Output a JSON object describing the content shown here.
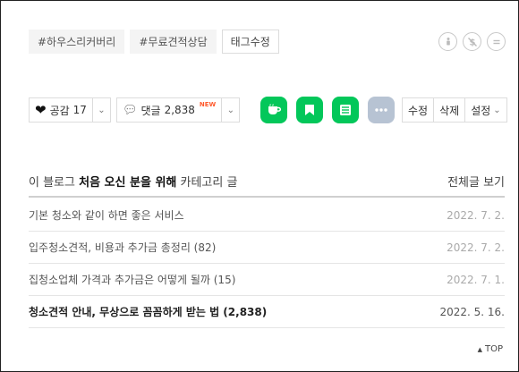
{
  "tags": [
    "#하우스리커버리",
    "#무료견적상담"
  ],
  "tag_edit_label": "태그수정",
  "cc_icons": [
    "cc-by-icon",
    "cc-nc-icon",
    "cc-nd-icon"
  ],
  "actions": {
    "like_label": "공감",
    "like_count": "17",
    "comment_label": "댓글",
    "comment_count": "2,838",
    "new_badge": "NEW"
  },
  "share_icons": [
    "cafe-icon",
    "blog-icon",
    "memo-icon",
    "more-icon"
  ],
  "manage": {
    "edit": "수정",
    "delete": "삭제",
    "settings": "설정"
  },
  "category": {
    "title_prefix": "이 블로그 ",
    "title_bold": "처음 오신 분을 위해",
    "title_suffix": " 카테고리 글",
    "view_all": "전체글 보기"
  },
  "posts": [
    {
      "title": "기본 청소와 같이 하면 좋은 서비스",
      "date": "2022. 7. 2."
    },
    {
      "title": "입주청소견적, 비용과 추가금 총정리 (82)",
      "date": "2022. 7. 2."
    },
    {
      "title": "집청소업체 가격과 추가금은 어떻게 될까 (15)",
      "date": "2022. 7. 1."
    },
    {
      "title": "청소견적 안내, 무상으로 꼼꼼하게 받는 법 (2,838)",
      "date": "2022. 5. 16."
    }
  ],
  "top_label": "TOP",
  "colors": {
    "green": "#03c75a",
    "new": "#ff5a2d",
    "more_gray": "#b7c3d3"
  }
}
